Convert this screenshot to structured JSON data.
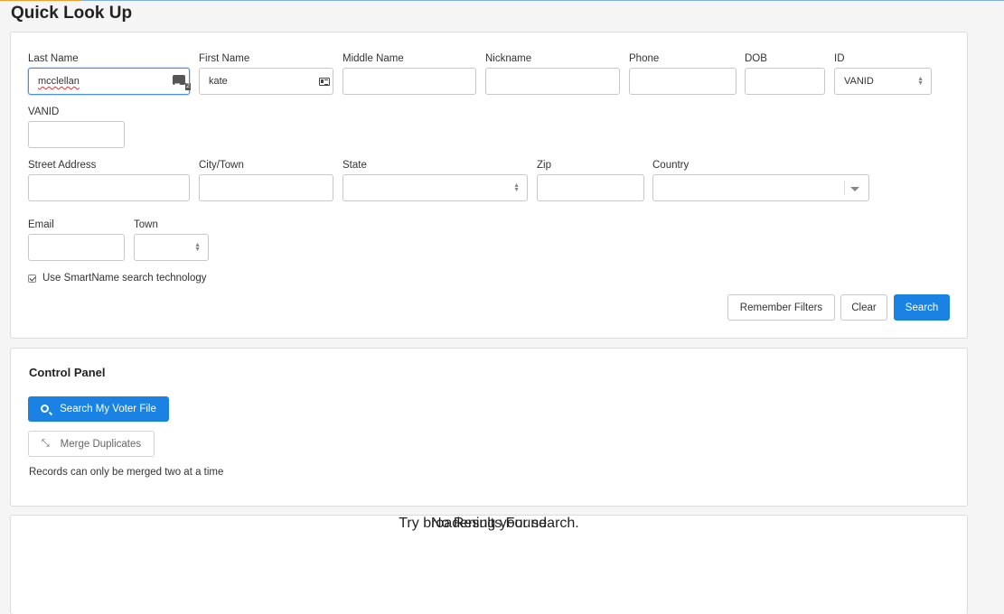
{
  "page": {
    "title": "Quick Look Up"
  },
  "filters": {
    "last_name": {
      "label": "Last Name",
      "value": "mcclellan"
    },
    "first_name": {
      "label": "First Name",
      "value": "kate"
    },
    "middle_name": {
      "label": "Middle Name",
      "value": ""
    },
    "nickname": {
      "label": "Nickname",
      "value": ""
    },
    "phone": {
      "label": "Phone",
      "value": ""
    },
    "dob": {
      "label": "DOB",
      "value": ""
    },
    "id": {
      "label": "ID",
      "value": "VANID"
    },
    "vanid": {
      "label": "VANID",
      "value": ""
    },
    "street_address": {
      "label": "Street Address",
      "value": ""
    },
    "city_town": {
      "label": "City/Town",
      "value": ""
    },
    "state": {
      "label": "State",
      "value": ""
    },
    "zip": {
      "label": "Zip",
      "value": ""
    },
    "country": {
      "label": "Country",
      "value": ""
    },
    "email": {
      "label": "Email",
      "value": ""
    },
    "town": {
      "label": "Town",
      "value": ""
    },
    "smartname": {
      "label": "Use SmartName search technology",
      "checked": true
    },
    "buttons": {
      "remember": "Remember Filters",
      "clear": "Clear",
      "search": "Search"
    }
  },
  "control_panel": {
    "title": "Control Panel",
    "search_voter_file": "Search My Voter File",
    "merge_duplicates": "Merge Duplicates",
    "note": "Records can only be merged two at a time"
  },
  "results": {
    "empty_title": "No Results Found",
    "empty_hint": "Try broadening your search."
  },
  "colors": {
    "primary": "#1a82e2",
    "focus_border": "#4a90d9"
  },
  "icons": [
    "password-manager-icon",
    "contact-card-icon",
    "select-arrows-icon",
    "chevron-down-icon",
    "checkbox-icon",
    "search-icon",
    "merge-icon"
  ]
}
